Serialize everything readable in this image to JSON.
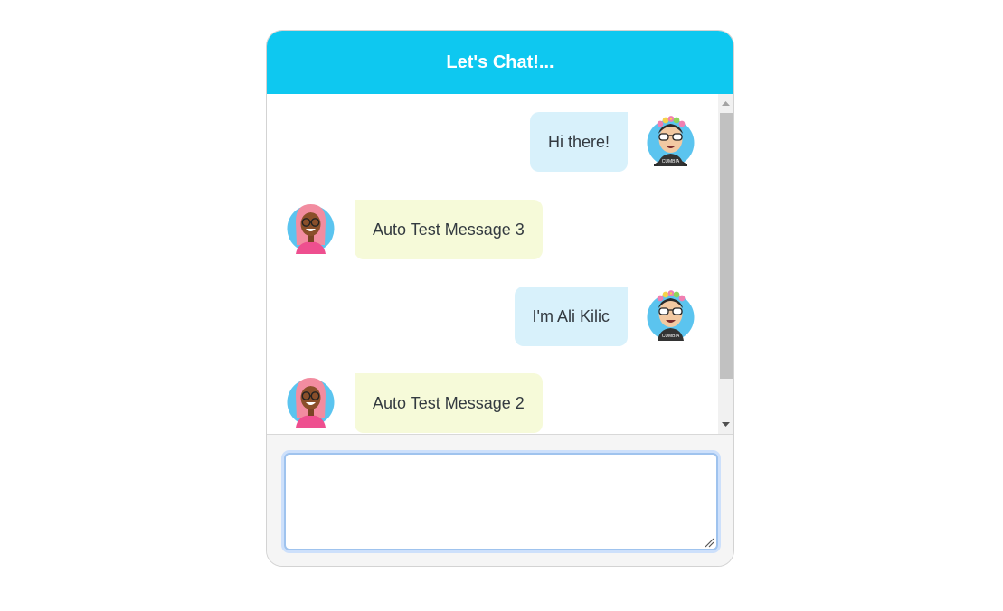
{
  "header": {
    "title": "Let's Chat!..."
  },
  "messages": [
    {
      "direction": "sent",
      "text": "Hi there!",
      "avatar": "boy-sunglasses-flower-crown-avatar"
    },
    {
      "direction": "received",
      "text": "Auto Test Message 3",
      "avatar": "girl-pink-hair-glasses-avatar"
    },
    {
      "direction": "sent",
      "text": "I'm Ali Kilic",
      "avatar": "boy-sunglasses-flower-crown-avatar"
    },
    {
      "direction": "received",
      "text": "Auto Test Message 2",
      "avatar": "girl-pink-hair-glasses-avatar"
    }
  ],
  "compose": {
    "value": "",
    "placeholder": ""
  },
  "colors": {
    "header_bg": "#0ec8f0",
    "sent_bubble": "#d8f1fb",
    "received_bubble": "#f6fad9",
    "avatar_bg": "#5bc4ef",
    "input_focus": "#9fc3ee"
  }
}
